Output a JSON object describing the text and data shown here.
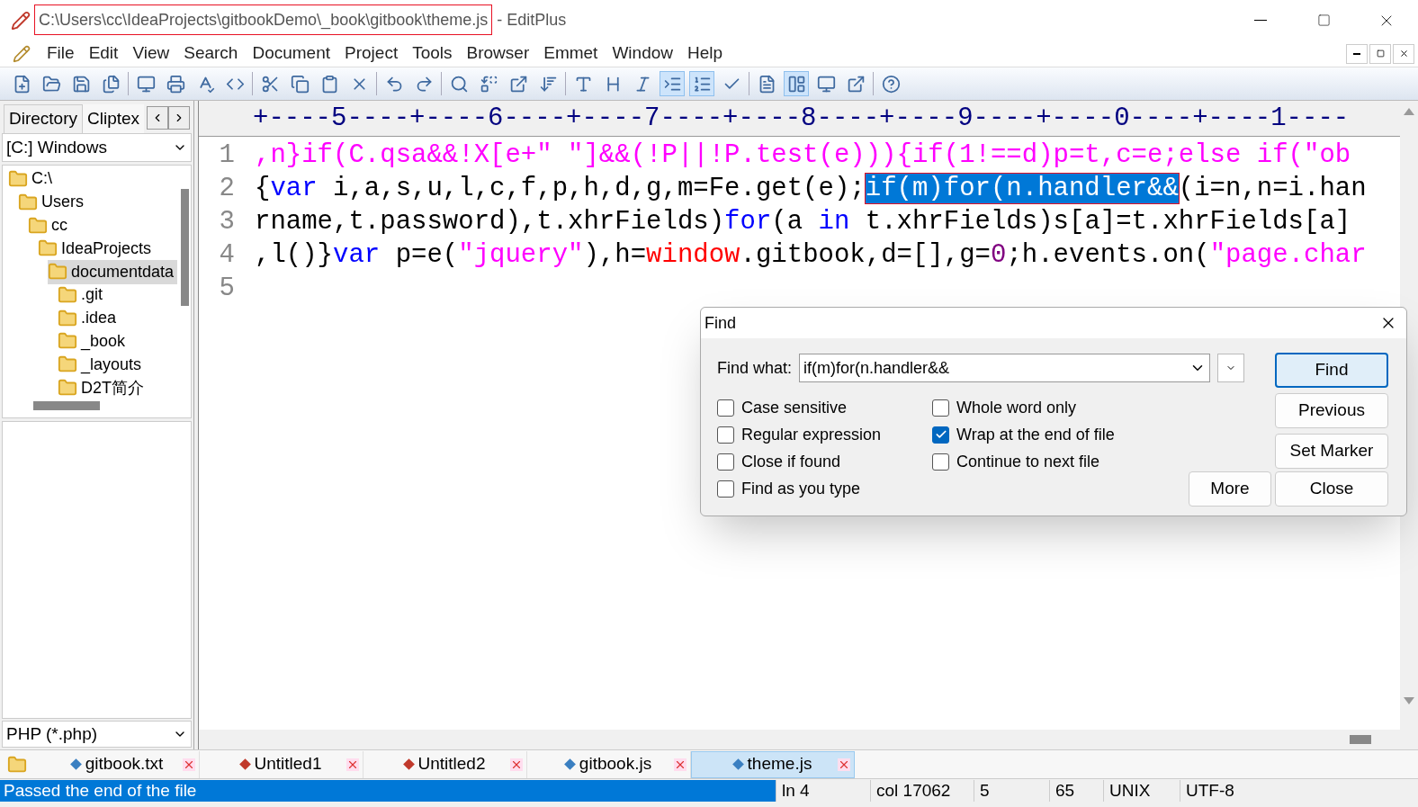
{
  "window": {
    "path": "C:\\Users\\cc\\IdeaProjects\\gitbookDemo\\_book\\gitbook\\theme.js",
    "app": " - EditPlus"
  },
  "menu": [
    "File",
    "Edit",
    "View",
    "Search",
    "Document",
    "Project",
    "Tools",
    "Browser",
    "Emmet",
    "Window",
    "Help"
  ],
  "sidebar": {
    "tabs": [
      {
        "label": "Directory",
        "selected": true
      },
      {
        "label": "Cliptex",
        "selected": false
      }
    ],
    "drive": "[C:] Windows",
    "tree": [
      {
        "label": "C:\\",
        "selected": false,
        "children": [
          {
            "label": "Users",
            "selected": false,
            "children": [
              {
                "label": "cc",
                "selected": false,
                "children": [
                  {
                    "label": "IdeaProjects",
                    "selected": false,
                    "children": [
                      {
                        "label": "documentdata",
                        "selected": true,
                        "children": [
                          {
                            "label": ".git",
                            "selected": false
                          },
                          {
                            "label": ".idea",
                            "selected": false
                          },
                          {
                            "label": "_book",
                            "selected": false
                          },
                          {
                            "label": "_layouts",
                            "selected": false
                          },
                          {
                            "label": "D2T简介",
                            "selected": false
                          }
                        ]
                      }
                    ]
                  }
                ]
              }
            ]
          }
        ]
      }
    ],
    "filter": "PHP (*.php)"
  },
  "ruler": "+----5----+----6----+----7----+----8----+----9----+----0----+----1----",
  "editor": {
    "lines": [
      {
        "number": "1",
        "segments": [
          {
            "kind": "string",
            "text": ",n}if(C.qsa&&!X[e+\" \"]&&(!P||!P.test(e))){if(1!==d)p=t,c=e;else if(\"ob"
          }
        ]
      },
      {
        "number": "2",
        "segments": [
          {
            "kind": "plain",
            "text": "{"
          },
          {
            "kind": "keyword",
            "text": "var"
          },
          {
            "kind": "plain",
            "text": " i,a,s,u,l,c,f,p,h,d,g,m=Fe.get(e);"
          },
          {
            "kind": "selected",
            "text": "if(m)for(n.handler&&"
          },
          {
            "kind": "plain",
            "text": "(i=n,n=i.han"
          }
        ]
      },
      {
        "number": "3",
        "segments": [
          {
            "kind": "plain",
            "text": "rname,t.password),t.xhrFields)"
          },
          {
            "kind": "keyword",
            "text": "for"
          },
          {
            "kind": "plain",
            "text": "(a "
          },
          {
            "kind": "keyword",
            "text": "in"
          },
          {
            "kind": "plain",
            "text": " t.xhrFields)s[a]=t.xhrFields[a]"
          }
        ]
      },
      {
        "number": "4",
        "segments": [
          {
            "kind": "plain",
            "text": ",l()}"
          },
          {
            "kind": "keyword",
            "text": "var"
          },
          {
            "kind": "plain",
            "text": " p=e("
          },
          {
            "kind": "string",
            "text": "\"jquery\""
          },
          {
            "kind": "plain",
            "text": "),h="
          },
          {
            "kind": "builtin",
            "text": "window"
          },
          {
            "kind": "plain",
            "text": ".gitbook,d=[],g="
          },
          {
            "kind": "number",
            "text": "0"
          },
          {
            "kind": "plain",
            "text": ";h.events.on("
          },
          {
            "kind": "string",
            "text": "\"page.char"
          }
        ]
      },
      {
        "number": "5"
      }
    ]
  },
  "find_dialog": {
    "title": "Find",
    "label": "Find what:",
    "value": "if(m)for(n.handler&&",
    "options": [
      {
        "label": "Case sensitive",
        "checked": false
      },
      {
        "label": "Regular expression",
        "checked": false
      },
      {
        "label": "Close if found",
        "checked": false
      },
      {
        "label": "Find as you type",
        "checked": false
      },
      {
        "label": "Whole word only",
        "checked": false
      },
      {
        "label": "Wrap at the end of file",
        "checked": true
      },
      {
        "label": "Continue to next file",
        "checked": false
      }
    ],
    "buttons": [
      "Find",
      "Previous",
      "Set Marker",
      "More",
      "Close"
    ]
  },
  "doc_tabs": [
    {
      "label": "gitbook.txt",
      "selected": false,
      "color": "#3a7fc1"
    },
    {
      "label": "Untitled1",
      "selected": false,
      "color": "#c0392b"
    },
    {
      "label": "Untitled2",
      "selected": false,
      "color": "#c0392b"
    },
    {
      "label": "gitbook.js",
      "selected": false,
      "color": "#3a7fc1"
    },
    {
      "label": "theme.js",
      "selected": true,
      "color": "#3a7fc1"
    }
  ],
  "status_bar": {
    "message": "Passed the end of the file",
    "fields": [
      "ln 4",
      "col 17062",
      "5",
      "65",
      "UNIX",
      "UTF-8"
    ]
  }
}
